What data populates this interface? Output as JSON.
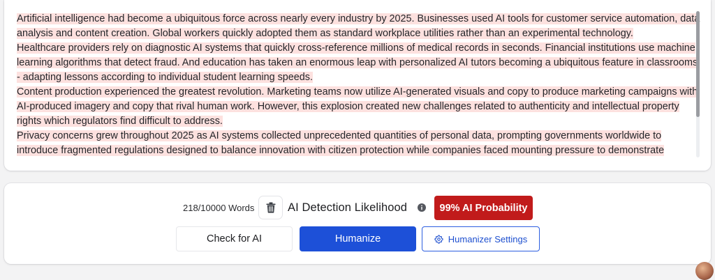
{
  "editor": {
    "paragraphs": [
      "Artificial intelligence had become a ubiquitous force across nearly every industry by 2025. Businesses used AI tools for customer service automation, data analysis and content creation. Global workers quickly adopted them as standard workplace utilities rather than an experimental technology.",
      " Healthcare providers rely on diagnostic AI systems that quickly cross-reference millions of medical records in seconds. Financial institutions use machine learning algorithms that detect fraud. And education has taken an enormous leap with personalized AI tutors becoming a ubiquitous feature in classrooms - adapting lessons according to individual student learning speeds.",
      " Content production experienced the greatest revolution. Marketing teams now utilize AI-generated visuals and copy to produce marketing campaigns with AI-produced imagery and copy that rival human work. However, this explosion created new challenges related to authenticity and intellectual property rights which regulators find difficult to address.",
      " Privacy concerns grew throughout 2025 as AI systems collected unprecedented quantities of personal data, prompting governments worldwide to introduce fragmented regulations designed to balance innovation with citizen protection while companies faced mounting pressure to demonstrate"
    ],
    "highlight_color": "#fde1df"
  },
  "toolbar": {
    "word_count": "218/10000 Words",
    "trash_icon": "trash-icon",
    "detection_label": "AI Detection Likelihood",
    "info_icon": "info-icon",
    "probability_badge": "99% AI Probability",
    "badge_color": "#c11b1b",
    "check_label": "Check for AI",
    "humanize_label": "Humanize",
    "humanize_color": "#1d50d8",
    "settings_label": "Humanizer Settings",
    "settings_icon": "gear-icon"
  }
}
